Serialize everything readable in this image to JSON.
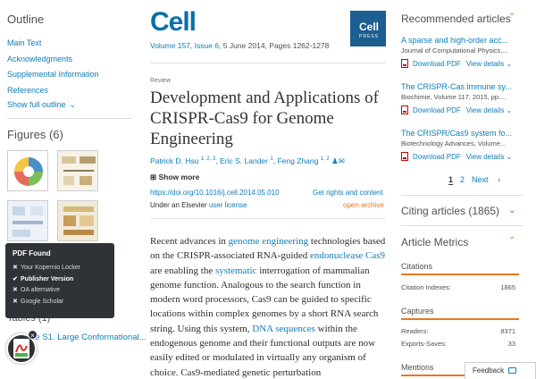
{
  "outline": {
    "title": "Outline",
    "items": [
      "Main Text",
      "Acknowledgments",
      "Supplemental Information",
      "References"
    ],
    "show_full": "Show full outline"
  },
  "figures": {
    "title": "Figures (6)"
  },
  "tables": {
    "title": "Tables (1)",
    "table_s1": "Table S1. Large Conformational..."
  },
  "pdf_popup": {
    "title": "PDF Found",
    "options": [
      {
        "label": "Your Kopernio Locker",
        "active": false
      },
      {
        "label": "Publisher Version",
        "active": true
      },
      {
        "label": "OA alternative",
        "active": false
      },
      {
        "label": "Google Scholar",
        "active": false
      }
    ]
  },
  "journal": {
    "logo": "Cell",
    "press": "CellPRESS",
    "press_short": "Cell",
    "press_sub": "PRESS",
    "info_link": "Volume 157, Issue 6",
    "info_rest": ", 5 June 2014, Pages 1262-1278"
  },
  "article": {
    "type": "Review",
    "title": "Development and Applications of CRISPR-Cas9 for Genome Engineering",
    "authors": [
      {
        "name": "Patrick D. Hsu",
        "sup": "1, 2, 3"
      },
      {
        "name": "Eric S. Lander",
        "sup": "1"
      },
      {
        "name": "Feng Zhang",
        "sup": "1, 2"
      }
    ],
    "show_more": "Show more",
    "doi": "https://doi.org/10.1016/j.cell.2014.05.010",
    "rights": "Get rights and content",
    "license_prefix": "Under an Elsevier ",
    "license_link": "user license",
    "open_archive": "open archive",
    "abstract_parts": [
      {
        "t": "Recent advances in ",
        "k": false
      },
      {
        "t": "genome engineering",
        "k": true
      },
      {
        "t": " technologies based on the CRISPR-associated RNA-guided ",
        "k": false
      },
      {
        "t": "endonuclease Cas9",
        "k": true
      },
      {
        "t": " are enabling the ",
        "k": false
      },
      {
        "t": "systematic",
        "k": true
      },
      {
        "t": " interrogation of mammalian genome function. Analogous to the search function in modern word processors, Cas9 can be guided to specific locations within complex genomes by a short RNA search string. Using this system, ",
        "k": false
      },
      {
        "t": "DNA sequences",
        "k": true
      },
      {
        "t": " within the endogenous genome and their functional outputs are now easily edited or modulated in virtually any organism of choice. Cas9-mediated genetic perturbation",
        "k": false
      }
    ]
  },
  "recommended": {
    "title": "Recommended articles",
    "items": [
      {
        "title": "A sparse and high-order acc...",
        "journal": "Journal of Computational Physics,...",
        "download": "Download PDF",
        "details": "View details"
      },
      {
        "title": "The CRISPR-Cas immune sy...",
        "journal": "Biochimie, Volume 117, 2015, pp....",
        "download": "Download PDF",
        "details": "View details"
      },
      {
        "title": "The CRISPR/Cas9 system fo...",
        "journal": "Biotechnology Advances, Volume...",
        "download": "Download PDF",
        "details": "View details"
      }
    ],
    "pager": {
      "p1": "1",
      "p2": "2",
      "next": "Next"
    }
  },
  "citing": {
    "title": "Citing articles (1865)"
  },
  "metrics": {
    "title": "Article Metrics",
    "citations": {
      "head": "Citations",
      "label": "Citation Indexes:",
      "value": "1865"
    },
    "captures": {
      "head": "Captures",
      "readers_label": "Readers:",
      "readers": "8371",
      "exports_label": "Exports-Saves:",
      "exports": "33"
    },
    "mentions": {
      "head": "Mentions"
    }
  },
  "feedback": {
    "label": "Feedback"
  },
  "colors": {
    "link": "#0c7dbb",
    "accent": "#e87722",
    "popup_bg": "#2f3337"
  }
}
